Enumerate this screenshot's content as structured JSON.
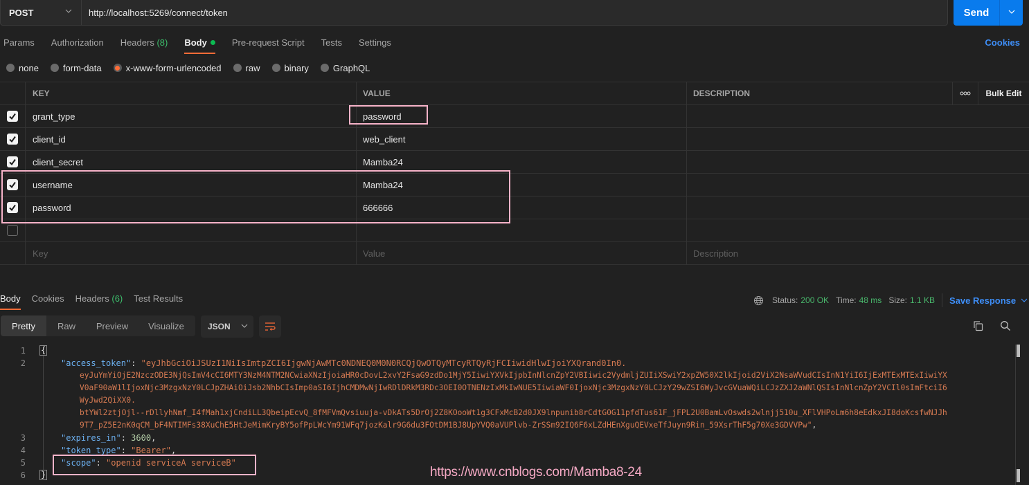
{
  "request": {
    "method": "POST",
    "url": "http://localhost:5269/connect/token",
    "send_label": "Send"
  },
  "request_tabs": [
    {
      "label": "Params"
    },
    {
      "label": "Authorization"
    },
    {
      "label": "Headers",
      "count": "(8)"
    },
    {
      "label": "Body",
      "active": true
    },
    {
      "label": "Pre-request Script"
    },
    {
      "label": "Tests"
    },
    {
      "label": "Settings"
    }
  ],
  "cookies_label": "Cookies",
  "body_types": [
    {
      "label": "none"
    },
    {
      "label": "form-data"
    },
    {
      "label": "x-www-form-urlencoded",
      "selected": true
    },
    {
      "label": "raw"
    },
    {
      "label": "binary"
    },
    {
      "label": "GraphQL"
    }
  ],
  "params_table": {
    "headers": {
      "key": "KEY",
      "value": "VALUE",
      "description": "DESCRIPTION",
      "more": "ooo",
      "bulk_edit": "Bulk Edit"
    },
    "rows": [
      {
        "checked": true,
        "key": "grant_type",
        "value": "password",
        "description": ""
      },
      {
        "checked": true,
        "key": "client_id",
        "value": "web_client",
        "description": ""
      },
      {
        "checked": true,
        "key": "client_secret",
        "value": "Mamba24",
        "description": ""
      },
      {
        "checked": true,
        "key": "username",
        "value": "Mamba24",
        "description": ""
      },
      {
        "checked": true,
        "key": "password",
        "value": "666666",
        "description": ""
      },
      {
        "checked": false,
        "key": "",
        "value": "",
        "description": ""
      }
    ],
    "new_row_placeholders": {
      "key": "Key",
      "value": "Value",
      "description": "Description"
    }
  },
  "response": {
    "tabs": [
      {
        "label": "Body",
        "active": true
      },
      {
        "label": "Cookies"
      },
      {
        "label": "Headers",
        "count": "(6)"
      },
      {
        "label": "Test Results"
      }
    ],
    "status_label": "Status:",
    "status_value": "200 OK",
    "time_label": "Time:",
    "time_value": "48 ms",
    "size_label": "Size:",
    "size_value": "1.1 KB",
    "save_response_label": "Save Response",
    "view_modes": [
      "Pretty",
      "Raw",
      "Preview",
      "Visualize"
    ],
    "active_view": "Pretty",
    "format": "JSON",
    "body_lines": {
      "l1": "{",
      "access_token_key": "\"access_token\"",
      "access_token_parts": [
        "\"eyJhbGciOiJSUzI1NiIsImtpZCI6IjgwNjAwMTc0NDNEQ0M0N0RCQjQwOTQyMTcyRTQyRjFCIiwidHlwIjoiYXQrand0In0.",
        "eyJuYmYiOjE2NzczODE3NjQsImV4cCI6MTY3NzM4NTM2NCwiaXNzIjoiaHR0cDovL2xvY2FsaG9zdDo1MjY5IiwiYXVkIjpbInNlcnZpY2VBIiwic2VydmljZUIiXSwiY2xpZW50X2lkIjoid2ViX2NsaWVudCIsInN1YiI6IjExMTExMTExIiwiYX",
        "V0aF90aW1lIjoxNjc3MzgxNzY0LCJpZHAiOiJsb2NhbCIsImp0aSI6IjhCMDMwNjIwRDlDRkM3RDc3OEI0OTNENzIxMkIwNUE5IiwiaWF0IjoxNjc3MzgxNzY0LCJzY29wZSI6WyJvcGVuaWQiLCJzZXJ2aWNlQSIsInNlcnZpY2VCIl0sImFtciI6",
        "WyJwd2QiXX0.",
        "btYWl2ztjOjl--rDllyhNmf_I4fMah1xjCndiLL3QbeipEcvQ_8fMFVmQvsiuuja-vDkATs5DrOj2Z8KOooWt1g3CFxMcB2d0JX9lnpunib8rCdtG0G11pfdTus61F_jFPL2U0BamLvOswds2wlnjj510u_XFlVHPoLm6h8eEdkxJI8doKcsfwNJJh",
        "9T7_pZ5E2nK0qCM_bF4NTIMFs38XuChE5HtJeMimKryBY5ofPpLWcYm91WFq7jozKalr9G6du3FOtDM1BJ8UpYVQ0aVUPlvb-ZrSSm92IQ6F6xLZdHEnXguQEVxeTfJuyn9Rin_59XsrThF5g70Xe3GDVVPw\""
      ],
      "expires_in_key": "\"expires_in\"",
      "expires_in_value": "3600",
      "token_type_key": "\"token_type\"",
      "token_type_value": "\"Bearer\"",
      "scope_key": "\"scope\"",
      "scope_value": "\"openid serviceA serviceB\"",
      "l6": "}"
    },
    "line_numbers": [
      "1",
      "2",
      "3",
      "4",
      "5",
      "6"
    ]
  },
  "watermark": "https://www.cnblogs.com/Mamba8-24"
}
